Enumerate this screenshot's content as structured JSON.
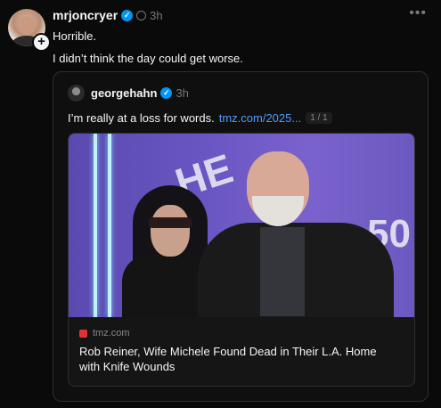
{
  "post": {
    "username": "mrjoncryer",
    "time": "3h",
    "lines": [
      "Horrible.",
      "I didn’t think the day could get worse."
    ]
  },
  "quote": {
    "username": "georgehahn",
    "time": "3h",
    "text": "I’m really at a loss for words.",
    "link": "tmz.com/2025...",
    "page_indicator": "1 / 1"
  },
  "link_preview": {
    "domain": "tmz.com",
    "title": "Rob Reiner, Wife Michele Found Dead in Their L.A. Home with Knife Wounds",
    "backdrop_text_1": "HE",
    "backdrop_text_2": "50"
  },
  "icons": {
    "follow": "plus-icon",
    "verified": "verified-badge-icon",
    "more": "more-options-icon"
  },
  "colors": {
    "background": "#0a0a0a",
    "link": "#4f9cff",
    "verified": "#0095f6"
  }
}
